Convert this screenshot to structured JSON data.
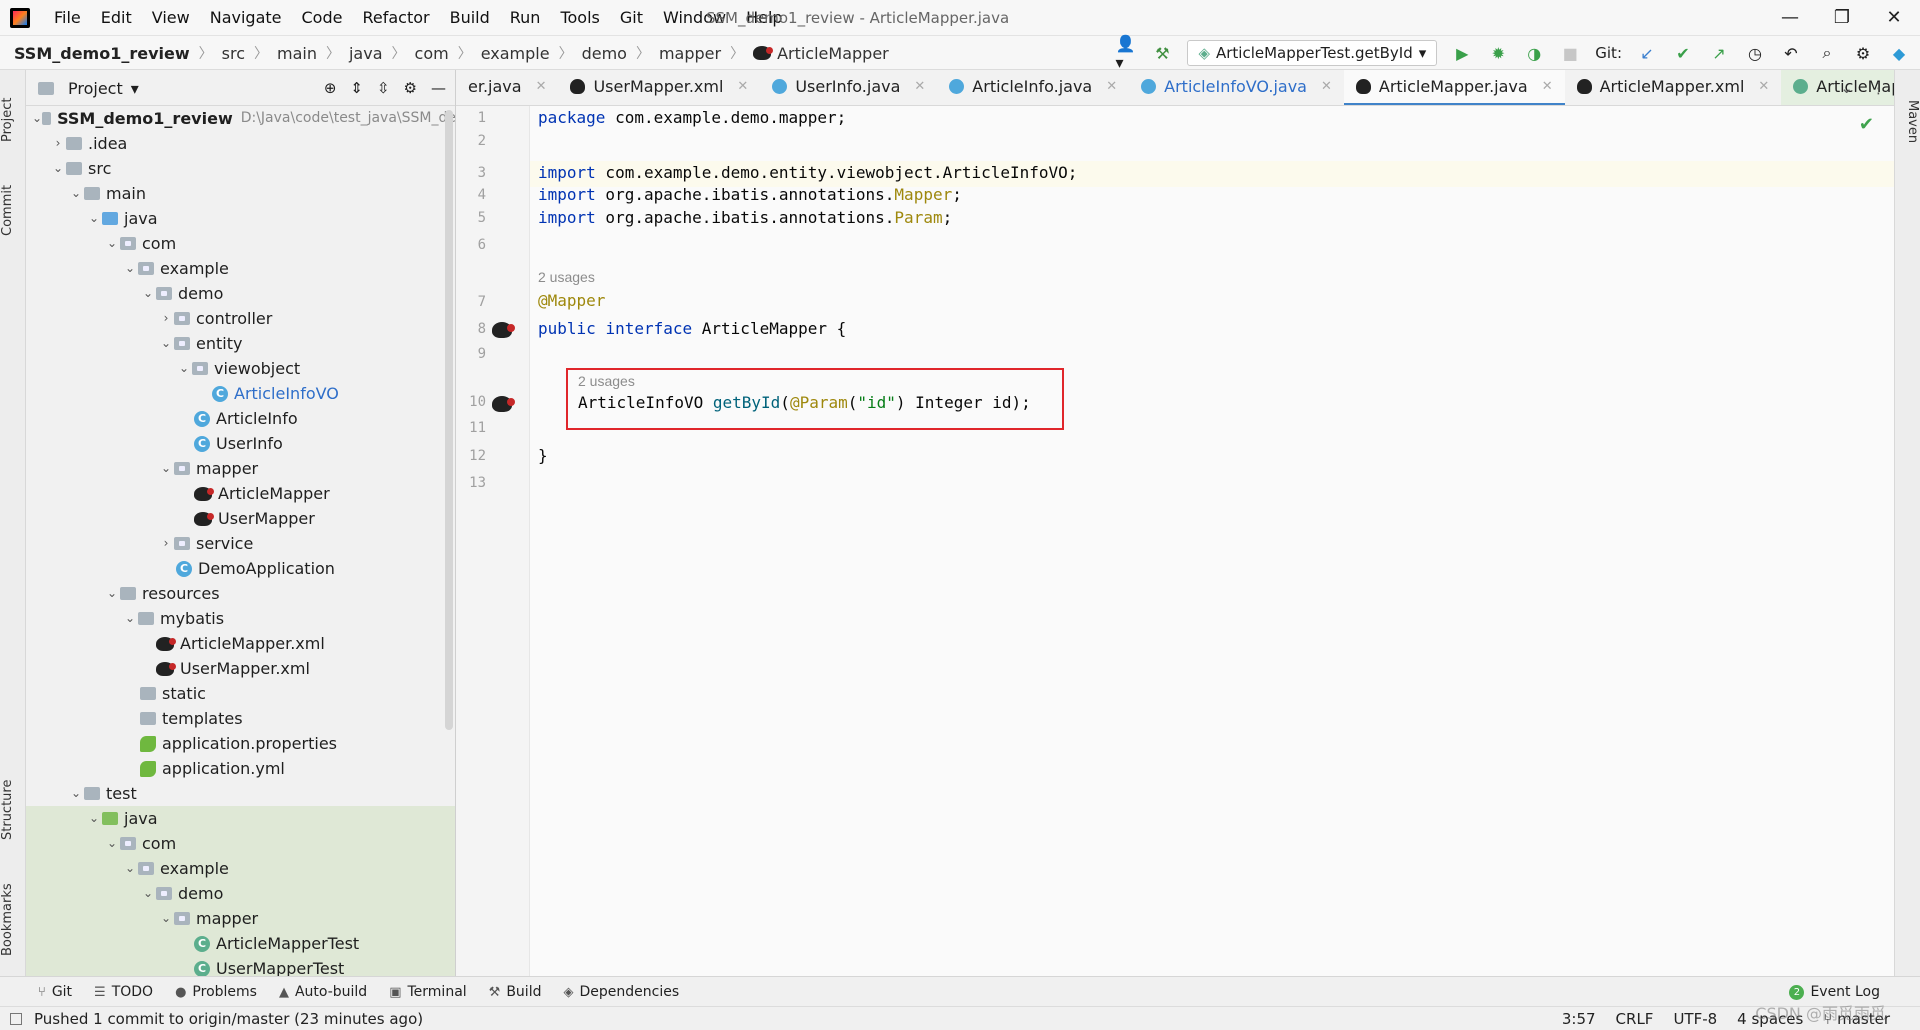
{
  "menu": [
    "File",
    "Edit",
    "View",
    "Navigate",
    "Code",
    "Refactor",
    "Build",
    "Run",
    "Tools",
    "Git",
    "Window",
    "Help"
  ],
  "window_title": "SSM_demo1_review - ArticleMapper.java",
  "window_controls": {
    "minimize": "—",
    "maximize": "❐",
    "close": "✕"
  },
  "breadcrumb": [
    "SSM_demo1_review",
    "src",
    "main",
    "java",
    "com",
    "example",
    "demo",
    "mapper",
    "ArticleMapper"
  ],
  "run_config": "ArticleMapperTest.getById",
  "git_label": "Git:",
  "left_strip": {
    "project": "Project",
    "commit": "Commit",
    "structure": "Structure",
    "bookmarks": "Bookmarks"
  },
  "right_strip": {
    "maven": "Maven"
  },
  "project_panel": {
    "title": "Project",
    "root_name": "SSM_demo1_review",
    "root_path": "D:\\Java\\code\\test_java\\SSM_de",
    "items": [
      {
        "label": ".idea"
      },
      {
        "label": "src"
      },
      {
        "label": "main"
      },
      {
        "label": "java"
      },
      {
        "label": "com"
      },
      {
        "label": "example"
      },
      {
        "label": "demo"
      },
      {
        "label": "controller"
      },
      {
        "label": "entity"
      },
      {
        "label": "viewobject"
      },
      {
        "label": "ArticleInfoVO"
      },
      {
        "label": "ArticleInfo"
      },
      {
        "label": "UserInfo"
      },
      {
        "label": "mapper"
      },
      {
        "label": "ArticleMapper"
      },
      {
        "label": "UserMapper"
      },
      {
        "label": "service"
      },
      {
        "label": "DemoApplication"
      },
      {
        "label": "resources"
      },
      {
        "label": "mybatis"
      },
      {
        "label": "ArticleMapper.xml"
      },
      {
        "label": "UserMapper.xml"
      },
      {
        "label": "static"
      },
      {
        "label": "templates"
      },
      {
        "label": "application.properties"
      },
      {
        "label": "application.yml"
      },
      {
        "label": "test"
      },
      {
        "label": "java"
      },
      {
        "label": "com"
      },
      {
        "label": "example"
      },
      {
        "label": "demo"
      },
      {
        "label": "mapper"
      },
      {
        "label": "ArticleMapperTest"
      },
      {
        "label": "UserMapperTest"
      }
    ]
  },
  "editor_tabs": [
    {
      "label": "er.java"
    },
    {
      "label": "UserMapper.xml"
    },
    {
      "label": "UserInfo.java"
    },
    {
      "label": "ArticleInfo.java"
    },
    {
      "label": "ArticleInfoVO.java"
    },
    {
      "label": "ArticleMapper.java"
    },
    {
      "label": "ArticleMapper.xml"
    },
    {
      "label": "ArticleMapperTest.java"
    }
  ],
  "code": {
    "line_numbers": [
      "1",
      "2",
      "3",
      "4",
      "5",
      "6",
      "7",
      "8",
      "9",
      "10",
      "11",
      "12",
      "13"
    ],
    "l1_kw": "package",
    "l1_rest": " com.example.demo.mapper;",
    "l3_kw": "import",
    "l3_rest": " com.example.demo.entity.viewobject.ArticleInfoVO;",
    "l4_kw": "import",
    "l4_rest": " org.apache.ibatis.annotations.",
    "l4_ann": "Mapper",
    "l4_end": ";",
    "l5_kw": "import",
    "l5_rest": " org.apache.ibatis.annotations.",
    "l5_ann": "Param",
    "l5_end": ";",
    "usages_1": "2 usages",
    "l7_ann": "@Mapper",
    "l8_kw1": "public",
    "l8_kw2": "interface",
    "l8_rest": " ArticleMapper {",
    "usages_2": "2 usages",
    "l10_type": "ArticleInfoVO ",
    "l10_fn": "getById",
    "l10_paren": "(",
    "l10_ann": "@Param",
    "l10_p2": "(",
    "l10_str": "\"id\"",
    "l10_rest": ") Integer id);",
    "l12": "}"
  },
  "bottom_tools": [
    "Git",
    "TODO",
    "Problems",
    "Auto-build",
    "Terminal",
    "Build",
    "Dependencies"
  ],
  "event_log": {
    "count": "2",
    "label": "Event Log"
  },
  "status": {
    "message": "Pushed 1 commit to origin/master (23 minutes ago)",
    "position": "3:57",
    "line_sep": "CRLF",
    "encoding": "UTF-8",
    "indent": "4 spaces",
    "branch": "master"
  },
  "watermark": "CSDN @雨觅雨觅"
}
